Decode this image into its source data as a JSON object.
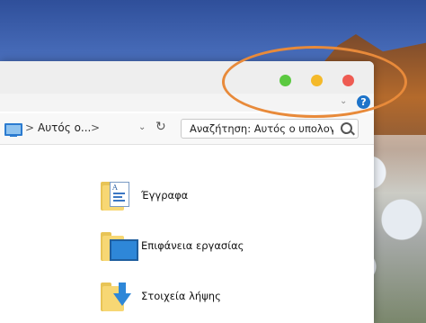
{
  "window": {
    "controls": [
      "green",
      "yellow",
      "red"
    ]
  },
  "breadcrumb": {
    "separator": ">",
    "location": "Αυτός ο...",
    "trailing_separator": ">"
  },
  "search": {
    "value": "Αναζήτηση: Αυτός ο υπολογι..."
  },
  "ribbon": {
    "help": "?"
  },
  "items": [
    {
      "label": "Έγγραφα",
      "icon": "documents-folder-icon"
    },
    {
      "label": "Επιφάνεια εργασίας",
      "icon": "desktop-folder-icon"
    },
    {
      "label": "Στοιχεία λήψης",
      "icon": "downloads-folder-icon"
    }
  ],
  "colors": {
    "highlight": "#e88a3a",
    "green": "#5bc940",
    "yellow": "#f4b92a",
    "red": "#ee5b52"
  }
}
